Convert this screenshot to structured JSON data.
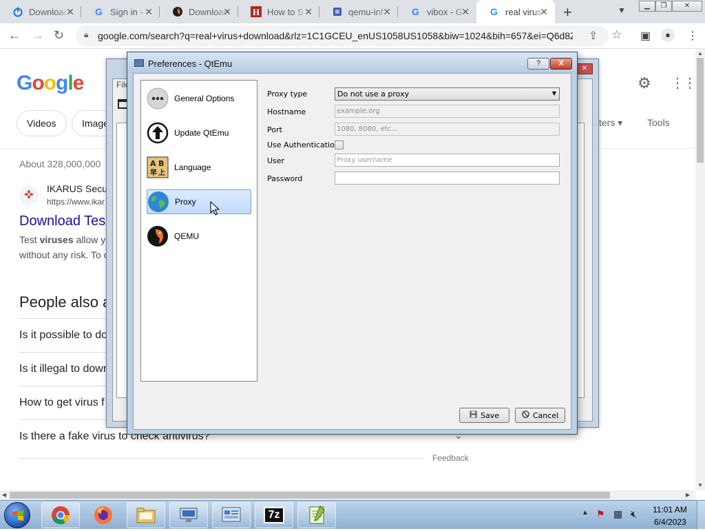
{
  "browser": {
    "tabs": [
      {
        "label": "Download",
        "icon": "power-icon",
        "active": false
      },
      {
        "label": "Sign in -",
        "icon": "google-g-icon",
        "active": false
      },
      {
        "label": "Download",
        "icon": "qemu-icon",
        "active": false
      },
      {
        "label": "How to S",
        "icon": "h-letter-icon",
        "active": false
      },
      {
        "label": "qemu-inf",
        "icon": "doc-icon",
        "active": false
      },
      {
        "label": "vibox - G",
        "icon": "google-g-icon",
        "active": false
      },
      {
        "label": "real virus",
        "icon": "google-g-icon",
        "active": true
      }
    ],
    "new_tab_symbol": "+",
    "url": "google.com/search?q=real+virus+download&rlz=1C1GCEU_enUS1058US1058&biw=1024&bih=657&ei=Q6d8Z..."
  },
  "google": {
    "logo": [
      "G",
      "o",
      "o",
      "g",
      "l",
      "e"
    ],
    "chips": [
      "Videos",
      "Image"
    ],
    "filters_label": "ters",
    "tools_label": "Tools",
    "about": "About 328,000,000",
    "result_site": "IKARUS Secur",
    "result_url": "https://www.ikar",
    "result_title": "Download Tes",
    "snippet_line1_pre": "Test ",
    "snippet_line1_bold": "viruses",
    "snippet_line1_post": " allow yo",
    "snippet_line2": "without any risk. To c",
    "paa_heading": "People also a",
    "questions": [
      "Is it possible to do",
      "Is it illegal to down",
      "How to get virus f",
      "Is there a fake virus to check antivirus?"
    ],
    "feedback": "Feedback"
  },
  "qtemu_main": {
    "menu_partial": "File"
  },
  "dialog": {
    "title": "Preferences - QtEmu",
    "help_label": "?",
    "close_label": "X",
    "categories": [
      {
        "label": "General Options",
        "icon": "more-dots-icon",
        "selected": false
      },
      {
        "label": "Update QtEmu",
        "icon": "upload-arrow-icon",
        "selected": false
      },
      {
        "label": "Language",
        "icon": "language-icon",
        "selected": false
      },
      {
        "label": "Proxy",
        "icon": "globe-icon",
        "selected": true
      },
      {
        "label": "QEMU",
        "icon": "qemu-icon",
        "selected": false
      }
    ],
    "form": {
      "proxy_type_label": "Proxy type",
      "proxy_type_value": "Do not use a proxy",
      "hostname_label": "Hostname",
      "hostname_placeholder": "example.org",
      "port_label": "Port",
      "port_placeholder": "1080, 8080, etc...",
      "auth_label": "Use Authentication",
      "auth_checked": false,
      "user_label": "User",
      "user_placeholder": "Proxy username",
      "password_label": "Password",
      "password_value": ""
    },
    "save_label": "Save",
    "cancel_label": "Cancel"
  },
  "taskbar": {
    "apps": [
      "chrome-icon",
      "firefox-icon",
      "file-explorer-icon",
      "vm-manager-icon",
      "qtemu-icon",
      "7zip-icon",
      "notepadpp-icon"
    ],
    "zip_label": "7z",
    "time": "11:01 AM",
    "date": "6/4/2023"
  },
  "colors": {
    "accent": "#1a0dab",
    "dialog_frame": "#bcd0e6",
    "selected_item": "#c1dbfc",
    "taskbar": "#a7c3e0"
  }
}
